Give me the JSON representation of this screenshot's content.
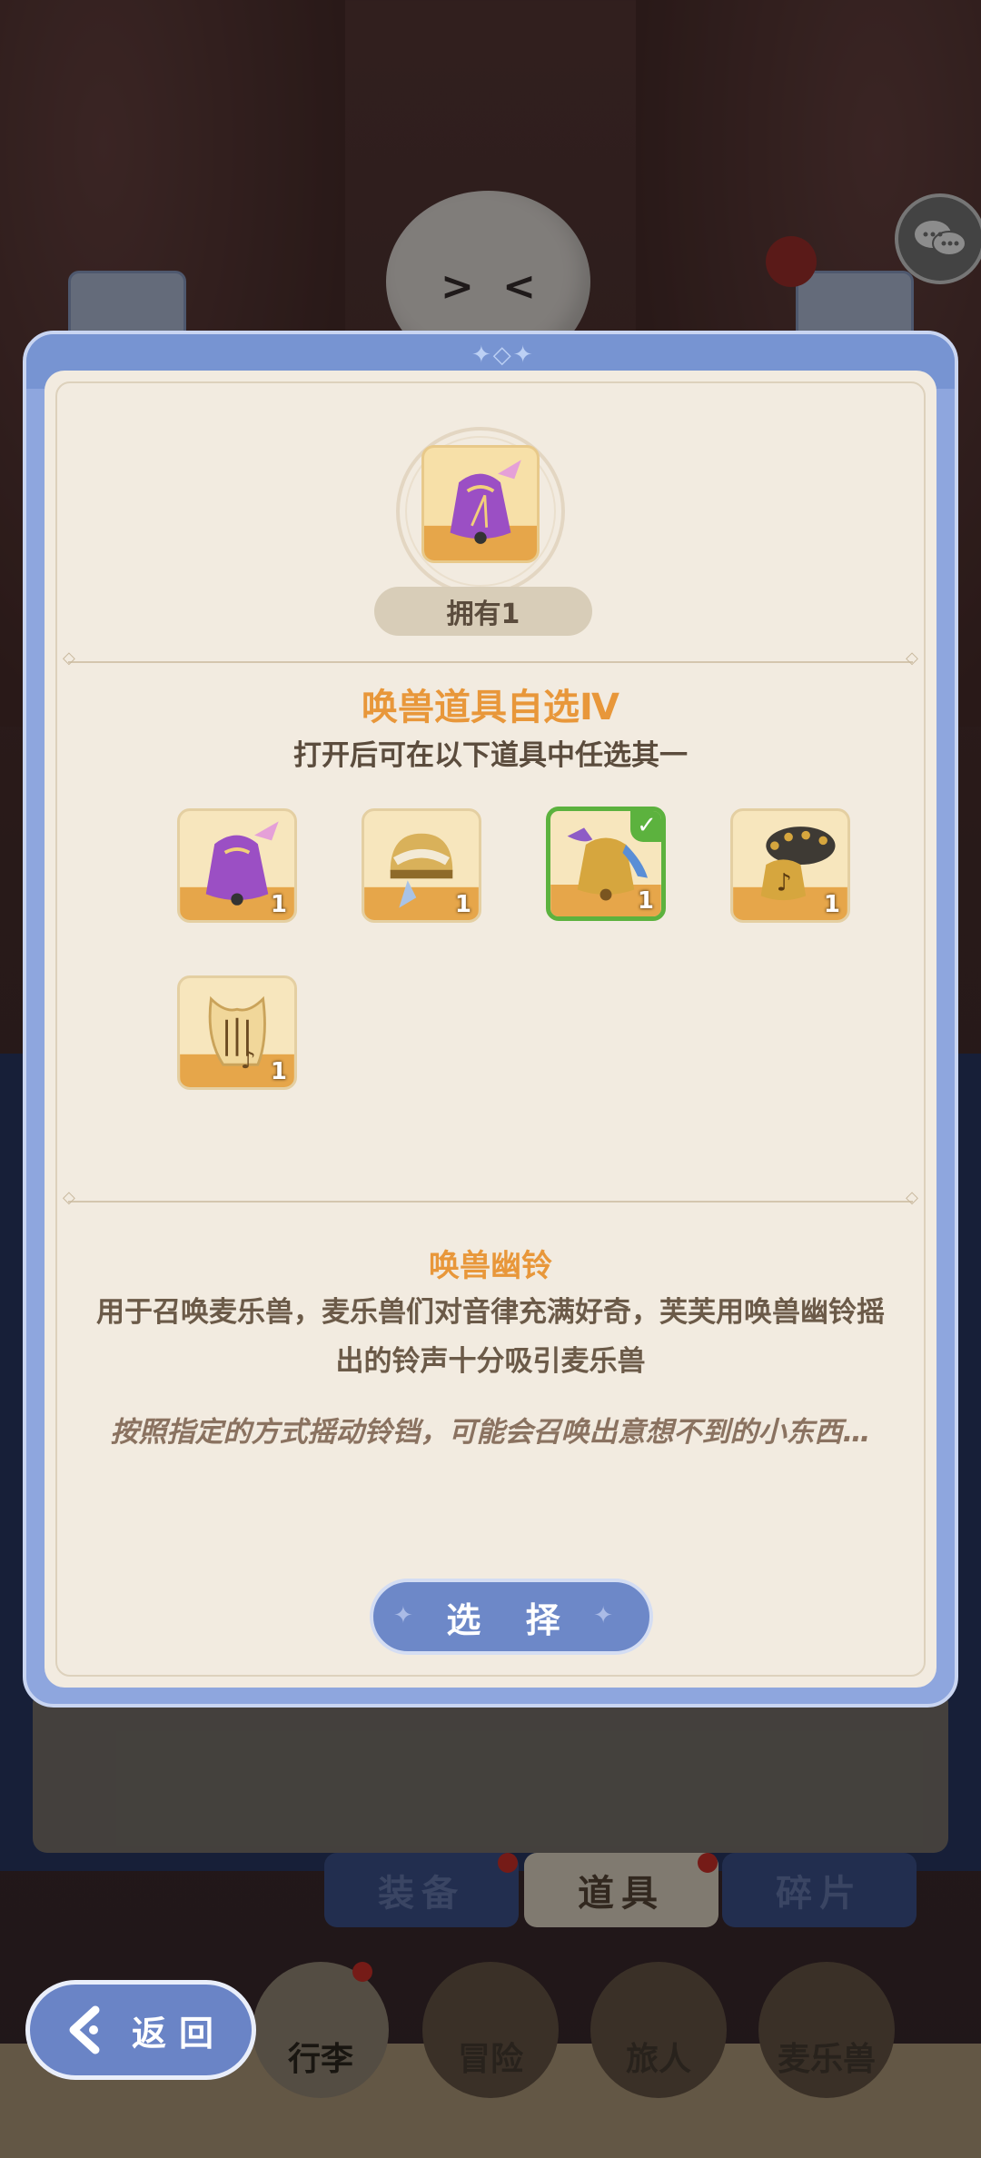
{
  "modal": {
    "owned_label": "拥有1",
    "title": "唤兽道具自选Ⅳ",
    "subtitle": "打开后可在以下道具中任选其一",
    "options": [
      {
        "icon": "purple-bell-icon",
        "count": "1",
        "selected": false
      },
      {
        "icon": "golden-helmet-bell-icon",
        "count": "1",
        "selected": false
      },
      {
        "icon": "ribbon-bell-icon",
        "count": "1",
        "selected": true
      },
      {
        "icon": "tambourine-bell-icon",
        "count": "1",
        "selected": false
      },
      {
        "icon": "lyre-icon",
        "count": "1",
        "selected": false
      }
    ],
    "item_name": "唤兽幽铃",
    "description": "用于召唤麦乐兽，麦乐兽们对音律充满好奇，芙芙用唤兽幽铃摇出的铃声十分吸引麦乐兽",
    "flavor": "按照指定的方式摇动铃铛，可能会召唤出意想不到的小东西…",
    "select_label": "选 择"
  },
  "category_tabs": {
    "equipment": "装备",
    "items": "道具",
    "fragments": "碎片"
  },
  "nav": {
    "back": "返回",
    "luggage": "行李",
    "adventure": "冒险",
    "traveler": "旅人",
    "melody_beast": "麦乐兽"
  },
  "colors": {
    "accent_orange": "#e8973a",
    "button_blue": "#6d88c8",
    "selected_green": "#5cb23e",
    "panel_cream": "#f2ebe0"
  }
}
